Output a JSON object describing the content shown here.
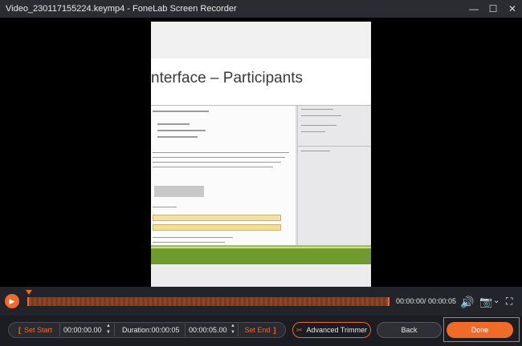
{
  "window": {
    "title": "Video_230117155224.keymp4  -  FoneLab Screen Recorder",
    "minimize_glyph": "—",
    "maximize_glyph": "☐",
    "close_glyph": "✕"
  },
  "preview": {
    "slide_title": "nterface – Participants"
  },
  "playback": {
    "play_glyph": "▶",
    "time_display": "00:00:00/ 00:00:05",
    "volume_glyph": "🔊",
    "camera_glyph": "📷",
    "camera_dropdown_glyph": "⌄",
    "fullscreen_glyph": "⛶",
    "progress_fraction": 1.0
  },
  "trim": {
    "set_start_label": "Set Start",
    "start_time": "00:00:00.00",
    "duration": "Duration:00:00:05",
    "end_time": "00:00:05.00",
    "set_end_label": "Set End",
    "bracket_open": "[",
    "bracket_close": "]",
    "spin_up": "▲",
    "spin_down": "▼"
  },
  "buttons": {
    "advanced_trimmer": "Advanced Trimmer",
    "back": "Back",
    "done": "Done"
  },
  "colors": {
    "accent": "#f06a28",
    "background": "#1e1f23",
    "stage": "#000000"
  },
  "icons": {
    "play": "play-icon",
    "volume": "volume-icon",
    "camera": "camera-icon",
    "fullscreen": "fullscreen-icon",
    "advanced_trimmer": "trimmer-icon"
  }
}
